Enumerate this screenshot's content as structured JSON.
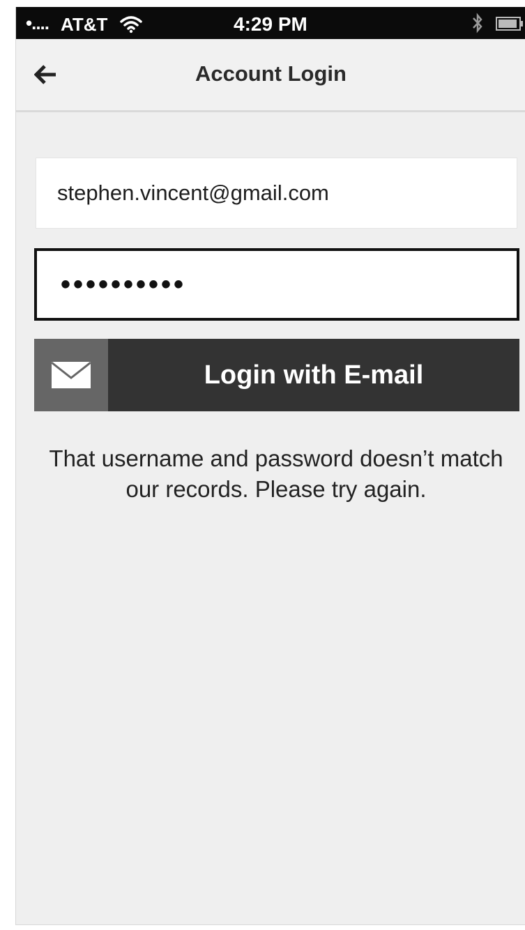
{
  "status_bar": {
    "signal": "•....",
    "carrier": "AT&T",
    "time": "4:29 PM"
  },
  "header": {
    "title": "Account Login"
  },
  "form": {
    "email_value": "stephen.vincent@gmail.com",
    "password_masked": "••••••••••",
    "login_button_label": "Login with E-mail"
  },
  "error": {
    "message": "That username and password doesn’t match our records. Please try again."
  },
  "icons": {
    "back": "back-arrow-icon",
    "login": "envelope-icon",
    "wifi": "wifi-icon",
    "bluetooth": "bluetooth-icon",
    "battery": "battery-icon"
  },
  "colors": {
    "button": "#333333",
    "button_icon_box": "#666666",
    "background": "#efefef"
  }
}
